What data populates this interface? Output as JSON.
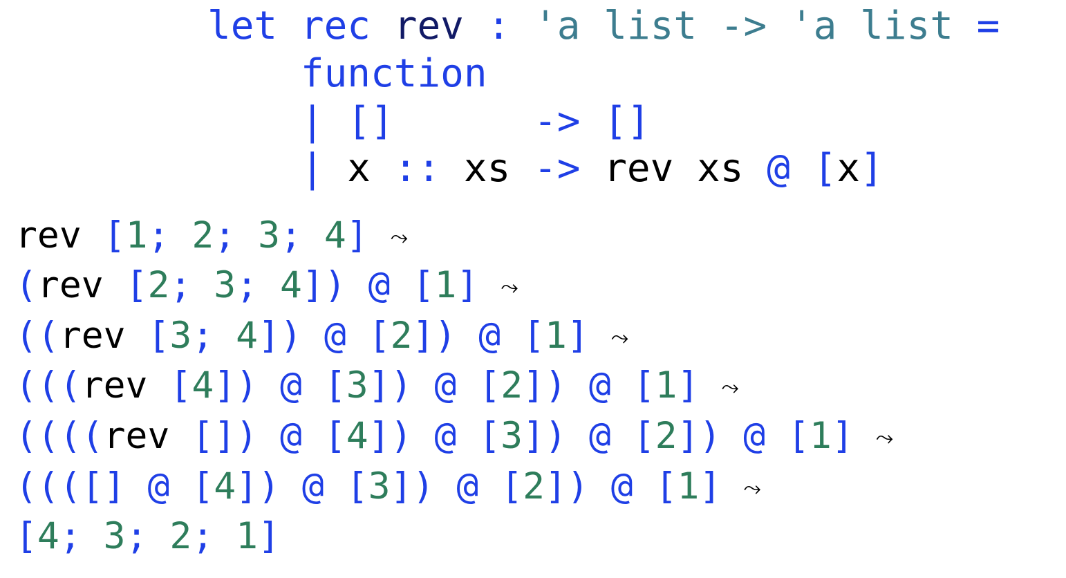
{
  "colors": {
    "keyword": "#1f3fe6",
    "function_name": "#111a66",
    "type": "#3d7d8f",
    "identifier": "#000000",
    "number": "#2e7d5b"
  },
  "definition": [
    [
      {
        "t": "let",
        "c": "kw"
      },
      {
        "t": " ",
        "c": "id"
      },
      {
        "t": "rec",
        "c": "kw"
      },
      {
        "t": " ",
        "c": "id"
      },
      {
        "t": "rev",
        "c": "name"
      },
      {
        "t": " ",
        "c": "id"
      },
      {
        "t": ":",
        "c": "kw"
      },
      {
        "t": " ",
        "c": "id"
      },
      {
        "t": "'a list -> 'a list",
        "c": "type"
      },
      {
        "t": " ",
        "c": "id"
      },
      {
        "t": "=",
        "c": "kw"
      }
    ],
    [
      {
        "t": "    ",
        "c": "id"
      },
      {
        "t": "function",
        "c": "kw"
      }
    ],
    [
      {
        "t": "    ",
        "c": "id"
      },
      {
        "t": "|",
        "c": "kw"
      },
      {
        "t": " ",
        "c": "id"
      },
      {
        "t": "[]",
        "c": "kw"
      },
      {
        "t": "      ",
        "c": "id"
      },
      {
        "t": "->",
        "c": "kw"
      },
      {
        "t": " ",
        "c": "id"
      },
      {
        "t": "[]",
        "c": "kw"
      }
    ],
    [
      {
        "t": "    ",
        "c": "id"
      },
      {
        "t": "|",
        "c": "kw"
      },
      {
        "t": " ",
        "c": "id"
      },
      {
        "t": "x",
        "c": "id"
      },
      {
        "t": " ",
        "c": "id"
      },
      {
        "t": "::",
        "c": "kw"
      },
      {
        "t": " ",
        "c": "id"
      },
      {
        "t": "xs",
        "c": "id"
      },
      {
        "t": " ",
        "c": "id"
      },
      {
        "t": "->",
        "c": "kw"
      },
      {
        "t": " ",
        "c": "id"
      },
      {
        "t": "rev",
        "c": "id"
      },
      {
        "t": " ",
        "c": "id"
      },
      {
        "t": "xs",
        "c": "id"
      },
      {
        "t": " ",
        "c": "id"
      },
      {
        "t": "@",
        "c": "kw"
      },
      {
        "t": " ",
        "c": "id"
      },
      {
        "t": "[",
        "c": "kw"
      },
      {
        "t": "x",
        "c": "id"
      },
      {
        "t": "]",
        "c": "kw"
      }
    ]
  ],
  "trace": [
    [
      {
        "t": "rev",
        "c": "id"
      },
      {
        "t": " ",
        "c": "id"
      },
      {
        "t": "[",
        "c": "kw"
      },
      {
        "t": "1",
        "c": "num"
      },
      {
        "t": "; ",
        "c": "kw"
      },
      {
        "t": "2",
        "c": "num"
      },
      {
        "t": "; ",
        "c": "kw"
      },
      {
        "t": "3",
        "c": "num"
      },
      {
        "t": "; ",
        "c": "kw"
      },
      {
        "t": "4",
        "c": "num"
      },
      {
        "t": "]",
        "c": "kw"
      },
      {
        "t": " ",
        "c": "id"
      },
      {
        "t": "⤳",
        "c": "arrow"
      }
    ],
    [
      {
        "t": "(",
        "c": "kw"
      },
      {
        "t": "rev",
        "c": "id"
      },
      {
        "t": " ",
        "c": "id"
      },
      {
        "t": "[",
        "c": "kw"
      },
      {
        "t": "2",
        "c": "num"
      },
      {
        "t": "; ",
        "c": "kw"
      },
      {
        "t": "3",
        "c": "num"
      },
      {
        "t": "; ",
        "c": "kw"
      },
      {
        "t": "4",
        "c": "num"
      },
      {
        "t": "])",
        "c": "kw"
      },
      {
        "t": " ",
        "c": "id"
      },
      {
        "t": "@",
        "c": "kw"
      },
      {
        "t": " ",
        "c": "id"
      },
      {
        "t": "[",
        "c": "kw"
      },
      {
        "t": "1",
        "c": "num"
      },
      {
        "t": "]",
        "c": "kw"
      },
      {
        "t": " ",
        "c": "id"
      },
      {
        "t": "⤳",
        "c": "arrow"
      }
    ],
    [
      {
        "t": "((",
        "c": "kw"
      },
      {
        "t": "rev",
        "c": "id"
      },
      {
        "t": " ",
        "c": "id"
      },
      {
        "t": "[",
        "c": "kw"
      },
      {
        "t": "3",
        "c": "num"
      },
      {
        "t": "; ",
        "c": "kw"
      },
      {
        "t": "4",
        "c": "num"
      },
      {
        "t": "])",
        "c": "kw"
      },
      {
        "t": " ",
        "c": "id"
      },
      {
        "t": "@",
        "c": "kw"
      },
      {
        "t": " ",
        "c": "id"
      },
      {
        "t": "[",
        "c": "kw"
      },
      {
        "t": "2",
        "c": "num"
      },
      {
        "t": "])",
        "c": "kw"
      },
      {
        "t": " ",
        "c": "id"
      },
      {
        "t": "@",
        "c": "kw"
      },
      {
        "t": " ",
        "c": "id"
      },
      {
        "t": "[",
        "c": "kw"
      },
      {
        "t": "1",
        "c": "num"
      },
      {
        "t": "]",
        "c": "kw"
      },
      {
        "t": " ",
        "c": "id"
      },
      {
        "t": "⤳",
        "c": "arrow"
      }
    ],
    [
      {
        "t": "(((",
        "c": "kw"
      },
      {
        "t": "rev",
        "c": "id"
      },
      {
        "t": " ",
        "c": "id"
      },
      {
        "t": "[",
        "c": "kw"
      },
      {
        "t": "4",
        "c": "num"
      },
      {
        "t": "])",
        "c": "kw"
      },
      {
        "t": " ",
        "c": "id"
      },
      {
        "t": "@",
        "c": "kw"
      },
      {
        "t": " ",
        "c": "id"
      },
      {
        "t": "[",
        "c": "kw"
      },
      {
        "t": "3",
        "c": "num"
      },
      {
        "t": "])",
        "c": "kw"
      },
      {
        "t": " ",
        "c": "id"
      },
      {
        "t": "@",
        "c": "kw"
      },
      {
        "t": " ",
        "c": "id"
      },
      {
        "t": "[",
        "c": "kw"
      },
      {
        "t": "2",
        "c": "num"
      },
      {
        "t": "])",
        "c": "kw"
      },
      {
        "t": " ",
        "c": "id"
      },
      {
        "t": "@",
        "c": "kw"
      },
      {
        "t": " ",
        "c": "id"
      },
      {
        "t": "[",
        "c": "kw"
      },
      {
        "t": "1",
        "c": "num"
      },
      {
        "t": "]",
        "c": "kw"
      },
      {
        "t": " ",
        "c": "id"
      },
      {
        "t": "⤳",
        "c": "arrow"
      }
    ],
    [
      {
        "t": "((((",
        "c": "kw"
      },
      {
        "t": "rev",
        "c": "id"
      },
      {
        "t": " ",
        "c": "id"
      },
      {
        "t": "[])",
        "c": "kw"
      },
      {
        "t": " ",
        "c": "id"
      },
      {
        "t": "@",
        "c": "kw"
      },
      {
        "t": " ",
        "c": "id"
      },
      {
        "t": "[",
        "c": "kw"
      },
      {
        "t": "4",
        "c": "num"
      },
      {
        "t": "])",
        "c": "kw"
      },
      {
        "t": " ",
        "c": "id"
      },
      {
        "t": "@",
        "c": "kw"
      },
      {
        "t": " ",
        "c": "id"
      },
      {
        "t": "[",
        "c": "kw"
      },
      {
        "t": "3",
        "c": "num"
      },
      {
        "t": "])",
        "c": "kw"
      },
      {
        "t": " ",
        "c": "id"
      },
      {
        "t": "@",
        "c": "kw"
      },
      {
        "t": " ",
        "c": "id"
      },
      {
        "t": "[",
        "c": "kw"
      },
      {
        "t": "2",
        "c": "num"
      },
      {
        "t": "])",
        "c": "kw"
      },
      {
        "t": " ",
        "c": "id"
      },
      {
        "t": "@",
        "c": "kw"
      },
      {
        "t": " ",
        "c": "id"
      },
      {
        "t": "[",
        "c": "kw"
      },
      {
        "t": "1",
        "c": "num"
      },
      {
        "t": "]",
        "c": "kw"
      },
      {
        "t": " ",
        "c": "id"
      },
      {
        "t": "⤳",
        "c": "arrow"
      }
    ],
    [
      {
        "t": "((([]",
        "c": "kw"
      },
      {
        "t": " ",
        "c": "id"
      },
      {
        "t": "@",
        "c": "kw"
      },
      {
        "t": " ",
        "c": "id"
      },
      {
        "t": "[",
        "c": "kw"
      },
      {
        "t": "4",
        "c": "num"
      },
      {
        "t": "])",
        "c": "kw"
      },
      {
        "t": " ",
        "c": "id"
      },
      {
        "t": "@",
        "c": "kw"
      },
      {
        "t": " ",
        "c": "id"
      },
      {
        "t": "[",
        "c": "kw"
      },
      {
        "t": "3",
        "c": "num"
      },
      {
        "t": "])",
        "c": "kw"
      },
      {
        "t": " ",
        "c": "id"
      },
      {
        "t": "@",
        "c": "kw"
      },
      {
        "t": " ",
        "c": "id"
      },
      {
        "t": "[",
        "c": "kw"
      },
      {
        "t": "2",
        "c": "num"
      },
      {
        "t": "])",
        "c": "kw"
      },
      {
        "t": " ",
        "c": "id"
      },
      {
        "t": "@",
        "c": "kw"
      },
      {
        "t": " ",
        "c": "id"
      },
      {
        "t": "[",
        "c": "kw"
      },
      {
        "t": "1",
        "c": "num"
      },
      {
        "t": "]",
        "c": "kw"
      },
      {
        "t": " ",
        "c": "id"
      },
      {
        "t": "⤳",
        "c": "arrow"
      }
    ],
    [
      {
        "t": "[",
        "c": "kw"
      },
      {
        "t": "4",
        "c": "num"
      },
      {
        "t": "; ",
        "c": "kw"
      },
      {
        "t": "3",
        "c": "num"
      },
      {
        "t": "; ",
        "c": "kw"
      },
      {
        "t": "2",
        "c": "num"
      },
      {
        "t": "; ",
        "c": "kw"
      },
      {
        "t": "1",
        "c": "num"
      },
      {
        "t": "]",
        "c": "kw"
      }
    ]
  ]
}
